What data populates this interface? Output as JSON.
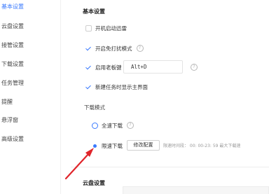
{
  "sidebar": {
    "items": [
      {
        "label": "基本设置",
        "active": true
      },
      {
        "label": "云盘设置",
        "active": false
      },
      {
        "label": "接管设置",
        "active": false
      },
      {
        "label": "下载设置",
        "active": false
      },
      {
        "label": "任务管理",
        "active": false
      },
      {
        "label": "提醒",
        "active": false
      },
      {
        "label": "悬浮窗",
        "active": false
      },
      {
        "label": "高级设置",
        "active": false
      }
    ]
  },
  "basic": {
    "title": "基本设置",
    "autostart": {
      "label": "开机启动迅雷",
      "checked": false
    },
    "dnd": {
      "label": "开启免打扰模式",
      "checked": true
    },
    "boss_key": {
      "label": "启用老板键",
      "checked": true,
      "hotkey": "Alt+D"
    },
    "show_main": {
      "label": "新建任务时显示主界面",
      "checked": true
    }
  },
  "download_mode": {
    "title": "下载模式",
    "full_speed": {
      "label": "全速下载",
      "selected": false
    },
    "limited": {
      "label": "限速下载",
      "selected": true
    },
    "edit_button": "修改配置",
    "limit_info": "限速时间段： 00: 00-23: 59  最大下载速"
  },
  "cloud": {
    "title": "云盘设置"
  },
  "colors": {
    "accent": "#3a7afe",
    "arrow": "#e0252b"
  },
  "icons": {
    "help": "?"
  }
}
